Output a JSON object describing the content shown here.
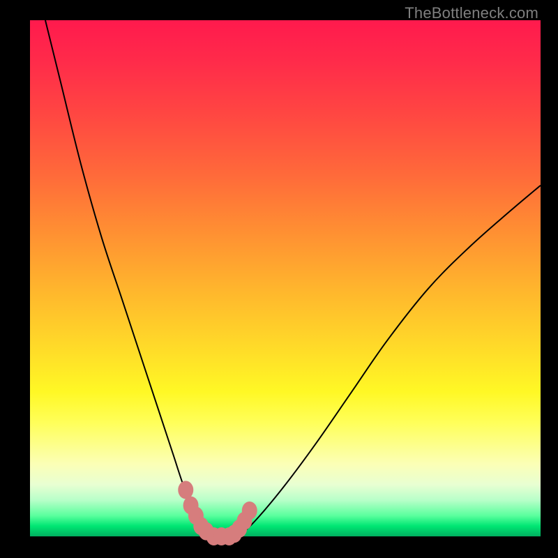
{
  "watermark": "TheBottleneck.com",
  "colors": {
    "black": "#000000",
    "curve_stroke": "#000000",
    "marker_fill": "#d67d7d",
    "marker_stroke": "#a55a5a",
    "grad_top": "#ff1a4d",
    "grad_bottom": "#00b060"
  },
  "chart_data": {
    "type": "line",
    "title": "",
    "xlabel": "",
    "ylabel": "",
    "xlim": [
      0,
      100
    ],
    "ylim": [
      0,
      100
    ],
    "legend": false,
    "grid": false,
    "series": [
      {
        "name": "left-curve",
        "x": [
          3,
          6,
          10,
          14,
          18,
          22,
          25,
          28,
          30,
          32,
          34,
          35
        ],
        "values": [
          100,
          88,
          72,
          58,
          46,
          34,
          25,
          16,
          10,
          5,
          1,
          0
        ]
      },
      {
        "name": "right-curve",
        "x": [
          40,
          42,
          45,
          50,
          56,
          63,
          70,
          78,
          86,
          94,
          100
        ],
        "values": [
          0,
          1,
          4,
          10,
          18,
          28,
          38,
          48,
          56,
          63,
          68
        ]
      },
      {
        "name": "flat-floor",
        "x": [
          35,
          40
        ],
        "values": [
          0,
          0
        ]
      }
    ],
    "markers": {
      "name": "dots",
      "color": "#d67d7d",
      "points": [
        {
          "x": 30.5,
          "y": 9
        },
        {
          "x": 31.5,
          "y": 6
        },
        {
          "x": 32.5,
          "y": 4
        },
        {
          "x": 33.5,
          "y": 2
        },
        {
          "x": 34.5,
          "y": 1
        },
        {
          "x": 36,
          "y": 0
        },
        {
          "x": 37.5,
          "y": 0
        },
        {
          "x": 39,
          "y": 0
        },
        {
          "x": 40,
          "y": 0.5
        },
        {
          "x": 41,
          "y": 1.5
        },
        {
          "x": 42,
          "y": 3
        },
        {
          "x": 43,
          "y": 5
        }
      ]
    }
  }
}
